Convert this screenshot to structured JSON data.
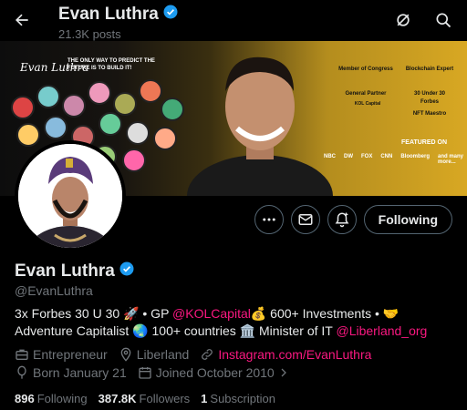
{
  "header": {
    "name": "Evan Luthra",
    "posts": "21.3K posts",
    "back_icon": "arrow-left-icon",
    "icons": [
      "grok-icon",
      "search-icon"
    ]
  },
  "banner": {
    "signature": "Evan Luthra",
    "tagline": "THE ONLY WAY TO PREDICT THE FUTURE IS TO BUILD IT!",
    "roles": {
      "member": "Member of Congress",
      "blockchain": "Blockchain Expert",
      "partner": "General Partner",
      "under30": "30 Under 30",
      "forbes": "Forbes",
      "nft": "NFT Maestro",
      "kol": "KOL Capital"
    },
    "featured_on": "FEATURED ON",
    "outlets": [
      "NBC",
      "DW",
      "FOX",
      "CNN",
      "Bloomberg"
    ],
    "more": "and many more..."
  },
  "actions": {
    "more_icon": "more-icon",
    "message_icon": "mail-icon",
    "notify_icon": "notification-bell-icon",
    "follow_label": "Following"
  },
  "profile": {
    "name": "Evan Luthra",
    "handle": "@EvanLuthra",
    "bio_part1": "3x Forbes 30 U 30 🚀 • GP ",
    "bio_link1": "@KOLCapital",
    "bio_part2": "💰 600+ Investments • 🤝 Adventure Capitalist 🌏 100+ countries 🏛️ Minister of IT ",
    "bio_link2": "@Liberland_org",
    "profession": "Entrepreneur",
    "location": "Liberland",
    "website": "Instagram.com/EvanLuthra",
    "birthday": "Born January 21",
    "joined": "Joined October 2010"
  },
  "stats": {
    "following_count": "896",
    "following_label": "Following",
    "followers_count": "387.8K",
    "followers_label": "Followers",
    "subscriptions_count": "1",
    "subscriptions_label": "Subscription"
  },
  "colors": {
    "verified": "#1d9bf0",
    "link": "#f91880",
    "muted": "#71767b",
    "gold": "#d8a823"
  }
}
